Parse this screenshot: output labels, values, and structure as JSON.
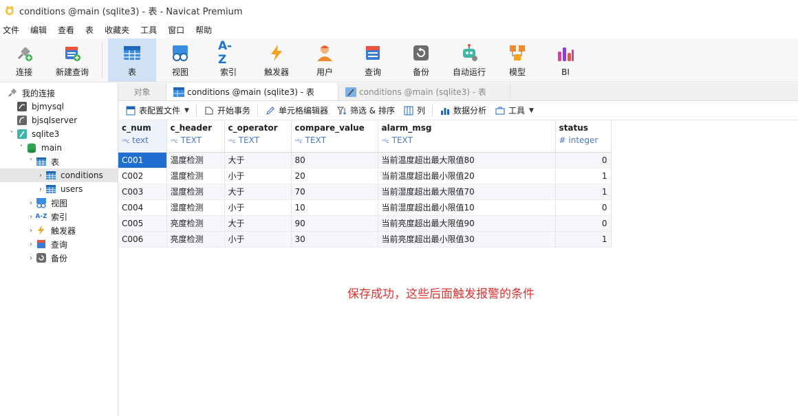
{
  "window": {
    "title": "conditions @main (sqlite3) - 表 - Navicat Premium"
  },
  "menu": [
    "文件",
    "编辑",
    "查看",
    "表",
    "收藏夹",
    "工具",
    "窗口",
    "帮助"
  ],
  "toolbar": {
    "connect": "连接",
    "new_query": "新建查询",
    "table": "表",
    "view": "视图",
    "index": "索引",
    "trigger": "触发器",
    "user": "用户",
    "query": "查询",
    "backup": "备份",
    "automation": "自动运行",
    "model": "模型",
    "bi": "BI",
    "index_glyph": "A-Z"
  },
  "sidebar": {
    "my_connections": "我的连接",
    "conn1": "bjmysql",
    "conn2": "bjsqlserver",
    "conn3": "sqlite3",
    "db": "main",
    "tables": "表",
    "table1": "conditions",
    "table2": "users",
    "views": "视图",
    "indexes": "索引",
    "triggers": "触发器",
    "queries": "查询",
    "backups": "备份"
  },
  "tabs": {
    "objects": "对象",
    "active": "conditions @main (sqlite3) - 表",
    "inactive": "conditions @main (sqlite3) - 表"
  },
  "subtoolbar": {
    "profile": "表配置文件",
    "begin_tx": "开始事务",
    "cell_editor": "单元格编辑器",
    "filter_sort": "筛选 & 排序",
    "columns": "列",
    "analysis": "数据分析",
    "tools": "工具"
  },
  "grid": {
    "columns": [
      {
        "name": "c_num",
        "type": "text"
      },
      {
        "name": "c_header",
        "type": "TEXT"
      },
      {
        "name": "c_operator",
        "type": "TEXT"
      },
      {
        "name": "compare_value",
        "type": "TEXT"
      },
      {
        "name": "alarm_msg",
        "type": "TEXT"
      },
      {
        "name": "status",
        "type": "integer"
      }
    ],
    "rows": [
      [
        "C001",
        "温度检测",
        "大于",
        "80",
        "当前温度超出最大限值80",
        "0"
      ],
      [
        "C002",
        "温度检测",
        "小于",
        "20",
        "当前温度超出最小限值20",
        "1"
      ],
      [
        "C003",
        "湿度检测",
        "大于",
        "70",
        "当前湿度超出最大限值70",
        "1"
      ],
      [
        "C004",
        "湿度检测",
        "小于",
        "10",
        "当前湿度超出最小限值10",
        "0"
      ],
      [
        "C005",
        "亮度检测",
        "大于",
        "90",
        "当前亮度超出最大限值90",
        "0"
      ],
      [
        "C006",
        "亮度检测",
        "小于",
        "30",
        "当前亮度超出最小限值30",
        "1"
      ]
    ]
  },
  "annotation": "保存成功，这些后面触发报警的条件"
}
